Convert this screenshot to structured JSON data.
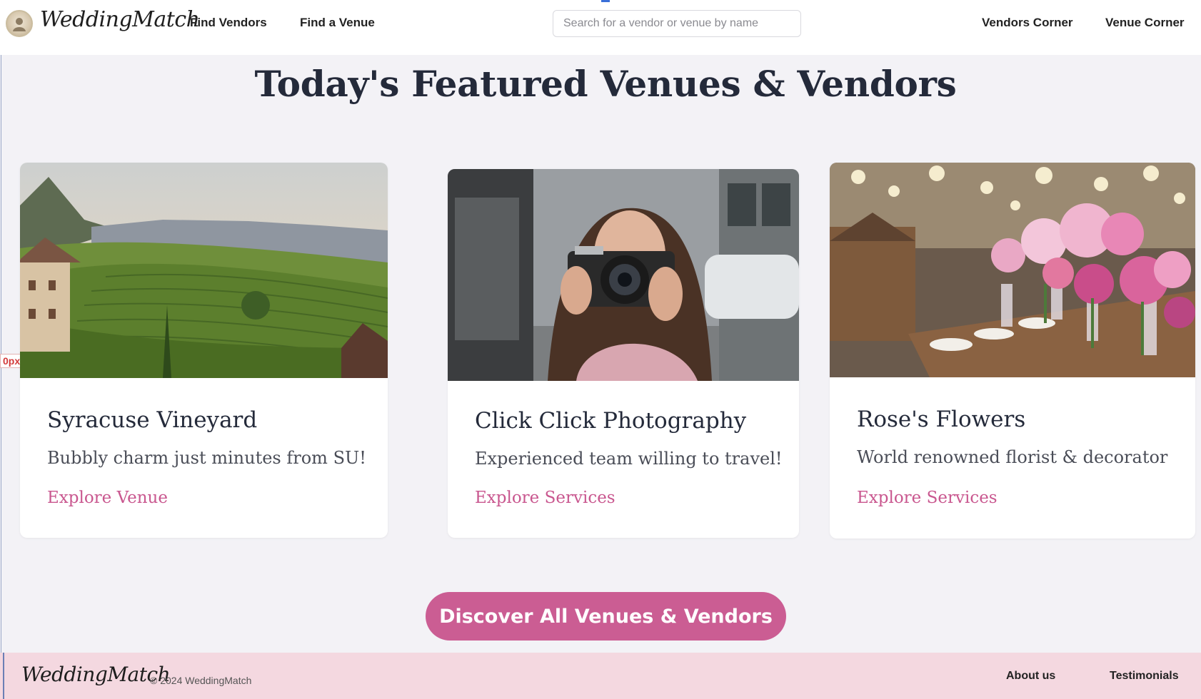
{
  "header": {
    "logo_text": "WeddingMatch",
    "nav": {
      "find_vendors": "Find Vendors",
      "find_venue": "Find a Venue",
      "vendors_corner": "Vendors Corner",
      "venue_corner": "Venue Corner"
    },
    "search": {
      "placeholder": "Search for a vendor or venue by name",
      "value": ""
    }
  },
  "debug_tag": "0px",
  "main": {
    "title": "Today's Featured Venues & Vendors",
    "cards": [
      {
        "title": "Syracuse Vineyard",
        "description": "Bubbly charm just minutes from SU!",
        "link": "Explore Venue",
        "image": "vineyard-landscape"
      },
      {
        "title": "Click Click Photography",
        "description": "Experienced team willing to travel!",
        "link": "Explore Services",
        "image": "photographer-with-camera"
      },
      {
        "title": "Rose's Flowers",
        "description": "World renowned florist & decorator",
        "link": "Explore Services",
        "image": "floral-table-arrangement"
      }
    ],
    "discover_button": "Discover All Venues & Vendors"
  },
  "footer": {
    "logo_text": "WeddingMatch",
    "copyright": "© 2024 WeddingMatch",
    "links": {
      "about": "About us",
      "testimonials": "Testimonials"
    }
  },
  "colors": {
    "accent": "#cb5d93",
    "page_background": "#f3f2f6",
    "footer_background": "#f4d8e0",
    "heading": "#242a3a"
  }
}
